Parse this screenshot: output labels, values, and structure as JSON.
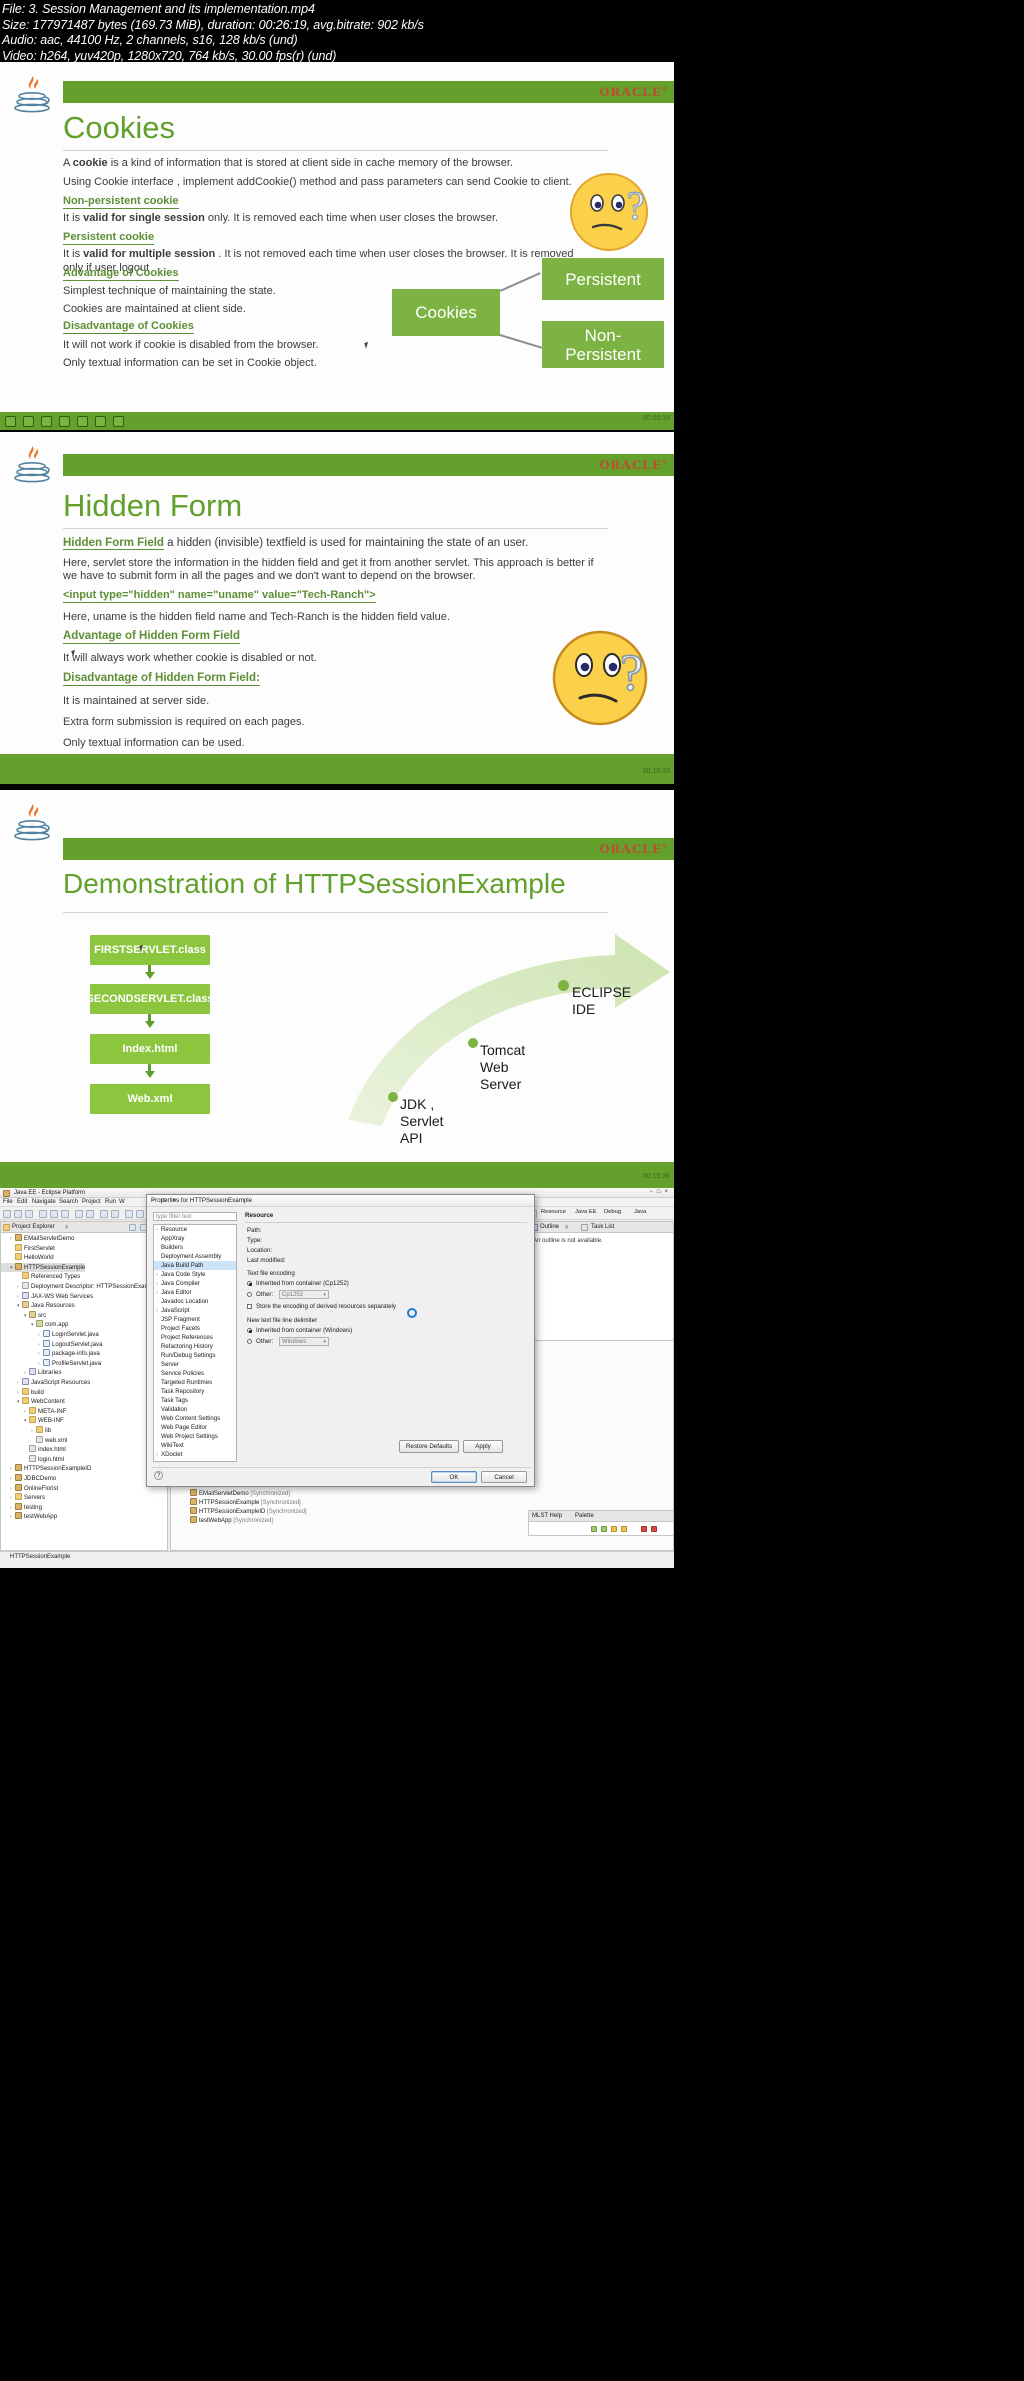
{
  "fileinfo": {
    "line1": "File: 3. Session Management and its implementation.mp4",
    "line2": "Size: 177971487 bytes (169.73 MiB), duration: 00:26:19, avg.bitrate: 902 kb/s",
    "line3": "Audio: aac, 44100 Hz, 2 channels, s16, 128 kb/s (und)",
    "line4": "Video: h264, yuv420p, 1280x720, 764 kb/s, 30.00 fps(r) (und)"
  },
  "brand": {
    "oracle": "ORACLE",
    "oracle_mark": "®",
    "green": "#63a02c",
    "title_green": "#62a02c",
    "box_green": "#7cb342",
    "flow_green": "#8cc63f"
  },
  "slide1": {
    "title": "Cookies",
    "line1_a": "A ",
    "line1_b": "cookie",
    "line1_c": " is a kind of information that is stored at client side in cache memory of the browser.",
    "line2": "Using Cookie interface , implement addCookie() method and pass parameters can send Cookie to client.",
    "sub1": "Non-persistent cookie",
    "line3_a": "It is ",
    "line3_b": "valid for single session",
    "line3_c": " only. It is removed each time when user closes the browser.",
    "sub2": "Persistent cookie",
    "line4_a": "It is ",
    "line4_b": "valid for multiple session",
    "line4_c": " . It is not removed each time when user closes the browser. It is removed only if user logout",
    "sub3": "Advantage of Cookies",
    "line5": "Simplest technique of maintaining the state.",
    "line6": "Cookies are maintained at client side.",
    "sub4": "Disadvantage of Cookies",
    "line7": "It will not work if cookie is disabled from the browser.",
    "line8": "Only textual information can be set in Cookie object.",
    "diagram": {
      "root": "Cookies",
      "branch1": "Persistent",
      "branch2": "Non-\nPersistent"
    },
    "timecode": "00:05:16"
  },
  "slide2": {
    "title": "Hidden Form",
    "line1_a": "Hidden Form Field",
    "line1_b": " a hidden (invisible) textfield is used for maintaining the state of an user.",
    "line2": "Here, servlet store the information in the hidden field and get it from another servlet. This approach is better if we have to submit form in all the pages and we don't want to depend on the browser.",
    "code": "<input type=\"hidden\" name=\"uname\" value=\"Tech-Ranch\">",
    "line3": "Here, uname is the hidden field name and Tech-Ranch is the hidden field value.",
    "sub1": "Advantage of Hidden Form Field",
    "line4": "It will always work whether cookie is disabled or not.",
    "sub2": "Disadvantage of Hidden Form Field:",
    "line5": "It is maintained at server side.",
    "line6": "Extra form submission is required on each pages.",
    "line7": "Only textual information can be used.",
    "timecode": "00:10:33"
  },
  "slide3": {
    "title": "Demonstration of HTTPSessionExample",
    "flow": [
      "FIRSTSERVLET.class",
      "SECONDSERVLET.class",
      "Index.html",
      "Web.xml"
    ],
    "stages": [
      "JDK ,\nServlet\nAPI",
      "Tomcat\nWeb\nServer",
      "ECLIPSE\nIDE"
    ],
    "timecode": "00:15:36"
  },
  "eclipse": {
    "window_title": "Java EE - Eclipse Platform",
    "menu": [
      "File",
      "Edit",
      "Navigate",
      "Search",
      "Project",
      "Run",
      "W"
    ],
    "perspectives": [
      "Resource",
      "Java EE",
      "Debug",
      "Java"
    ],
    "explorer_tab": "Project Explorer",
    "outline_tab": "Outline",
    "tasklist_tab": "Task List",
    "outline_message": "An outline is not available.",
    "palette_tab": "Palette",
    "help_tab": "MLST Help",
    "tree": [
      {
        "label": "EMailServletDemo",
        "depth": 1,
        "twisty": ">",
        "icon": "ic-proj"
      },
      {
        "label": "FirstServlet",
        "depth": 1,
        "twisty": "",
        "icon": "ic-folder"
      },
      {
        "label": "HelloWorld",
        "depth": 1,
        "twisty": "",
        "icon": "ic-folder"
      },
      {
        "label": "HTTPSessionExample",
        "depth": 1,
        "twisty": "v",
        "icon": "ic-proj",
        "selected": true
      },
      {
        "label": "Referenced Types",
        "depth": 2,
        "twisty": "",
        "icon": "ic-folder"
      },
      {
        "label": "Deployment Descriptor: HTTPSessionExam",
        "depth": 2,
        "twisty": ">",
        "icon": "ic-xml"
      },
      {
        "label": "JAX-WS Web Services",
        "depth": 2,
        "twisty": ">",
        "icon": "ic-lib"
      },
      {
        "label": "Java Resources",
        "depth": 2,
        "twisty": "v",
        "icon": "ic-src"
      },
      {
        "label": "src",
        "depth": 3,
        "twisty": "v",
        "icon": "ic-src"
      },
      {
        "label": "com.app",
        "depth": 4,
        "twisty": "v",
        "icon": "ic-pkg"
      },
      {
        "label": "LoginServlet.java",
        "depth": 5,
        "twisty": ">",
        "icon": "ic-java"
      },
      {
        "label": "LogoutServlet.java",
        "depth": 5,
        "twisty": ">",
        "icon": "ic-java"
      },
      {
        "label": "package-info.java",
        "depth": 5,
        "twisty": ">",
        "icon": "ic-java"
      },
      {
        "label": "ProfileServlet.java",
        "depth": 5,
        "twisty": ">",
        "icon": "ic-java"
      },
      {
        "label": "Libraries",
        "depth": 3,
        "twisty": ">",
        "icon": "ic-lib"
      },
      {
        "label": "JavaScript Resources",
        "depth": 2,
        "twisty": ">",
        "icon": "ic-lib"
      },
      {
        "label": "build",
        "depth": 2,
        "twisty": ">",
        "icon": "ic-folder"
      },
      {
        "label": "WebContent",
        "depth": 2,
        "twisty": "v",
        "icon": "ic-folder"
      },
      {
        "label": "META-INF",
        "depth": 3,
        "twisty": ">",
        "icon": "ic-folder"
      },
      {
        "label": "WEB-INF",
        "depth": 3,
        "twisty": "v",
        "icon": "ic-folder"
      },
      {
        "label": "lib",
        "depth": 4,
        "twisty": ">",
        "icon": "ic-folder"
      },
      {
        "label": "web.xml",
        "depth": 4,
        "twisty": "",
        "icon": "ic-xml"
      },
      {
        "label": "index.html",
        "depth": 3,
        "twisty": "",
        "icon": "ic-xml"
      },
      {
        "label": "login.html",
        "depth": 3,
        "twisty": "",
        "icon": "ic-xml"
      },
      {
        "label": "HTTPSessionExampleID",
        "depth": 1,
        "twisty": ">",
        "icon": "ic-proj"
      },
      {
        "label": "JDBCDemo",
        "depth": 1,
        "twisty": ">",
        "icon": "ic-proj"
      },
      {
        "label": "OnlineFlorist",
        "depth": 1,
        "twisty": ">",
        "icon": "ic-proj"
      },
      {
        "label": "Servers",
        "depth": 1,
        "twisty": ">",
        "icon": "ic-folder"
      },
      {
        "label": "testing",
        "depth": 1,
        "twisty": ">",
        "icon": "ic-proj"
      },
      {
        "label": "testWebApp",
        "depth": 1,
        "twisty": ">",
        "icon": "ic-proj"
      }
    ],
    "sync_rows": [
      {
        "name": "EMailServletDemo",
        "state": "[Synchronized]"
      },
      {
        "name": "HTTPSessionExample",
        "state": "[Synchronized]"
      },
      {
        "name": "HTTPSessionExampleID",
        "state": "[Synchronized]"
      },
      {
        "name": "testWebApp",
        "state": "[Synchronized]"
      }
    ],
    "status_text": "HTTPSessionExample",
    "dialog": {
      "title": "Properties for HTTPSessionExample",
      "filter_placeholder": "type filter text",
      "tree": [
        {
          "label": "Resource",
          "twisty": ">",
          "selected": false
        },
        {
          "label": "AppXray",
          "twisty": "",
          "selected": false
        },
        {
          "label": "Builders",
          "twisty": "",
          "selected": false
        },
        {
          "label": "Deployment Assembly",
          "twisty": "",
          "selected": false
        },
        {
          "label": "Java Build Path",
          "twisty": "",
          "selected": true
        },
        {
          "label": "Java Code Style",
          "twisty": ">",
          "selected": false
        },
        {
          "label": "Java Compiler",
          "twisty": ">",
          "selected": false
        },
        {
          "label": "Java Editor",
          "twisty": ">",
          "selected": false
        },
        {
          "label": "Javadoc Location",
          "twisty": "",
          "selected": false
        },
        {
          "label": "JavaScript",
          "twisty": ">",
          "selected": false
        },
        {
          "label": "JSP Fragment",
          "twisty": "",
          "selected": false
        },
        {
          "label": "Project Facets",
          "twisty": "",
          "selected": false
        },
        {
          "label": "Project References",
          "twisty": "",
          "selected": false
        },
        {
          "label": "Refactoring History",
          "twisty": "",
          "selected": false
        },
        {
          "label": "Run/Debug Settings",
          "twisty": "",
          "selected": false
        },
        {
          "label": "Server",
          "twisty": "",
          "selected": false
        },
        {
          "label": "Service Policies",
          "twisty": "",
          "selected": false
        },
        {
          "label": "Targeted Runtimes",
          "twisty": "",
          "selected": false
        },
        {
          "label": "Task Repository",
          "twisty": "",
          "selected": false
        },
        {
          "label": "Task Tags",
          "twisty": "",
          "selected": false
        },
        {
          "label": "Validation",
          "twisty": "",
          "selected": false
        },
        {
          "label": "Web Content Settings",
          "twisty": "",
          "selected": false
        },
        {
          "label": "Web Page Editor",
          "twisty": "",
          "selected": false
        },
        {
          "label": "Web Project Settings",
          "twisty": "",
          "selected": false
        },
        {
          "label": "WikiText",
          "twisty": "",
          "selected": false
        },
        {
          "label": "XDoclet",
          "twisty": ">",
          "selected": false
        }
      ],
      "page_title": "Resource",
      "fields": [
        {
          "label": "Path:",
          "value": ""
        },
        {
          "label": "Type:",
          "value": ""
        },
        {
          "label": "Location:",
          "value": ""
        },
        {
          "label": "Last modified:",
          "value": ""
        }
      ],
      "encoding_group": "Text file encoding",
      "encoding_inherit": "Inherited from container (Cp1252)",
      "encoding_other": "Other:",
      "encoding_other_value": "Cp1252",
      "encoding_store": "Store the encoding of derived resources separately",
      "delim_group": "New text file line delimiter",
      "delim_inherit": "Inherited from container (Windows)",
      "delim_other": "Other:",
      "delim_other_value": "Windows",
      "restore_defaults": "Restore Defaults",
      "apply": "Apply",
      "ok": "OK",
      "cancel": "Cancel",
      "help": "?"
    }
  }
}
